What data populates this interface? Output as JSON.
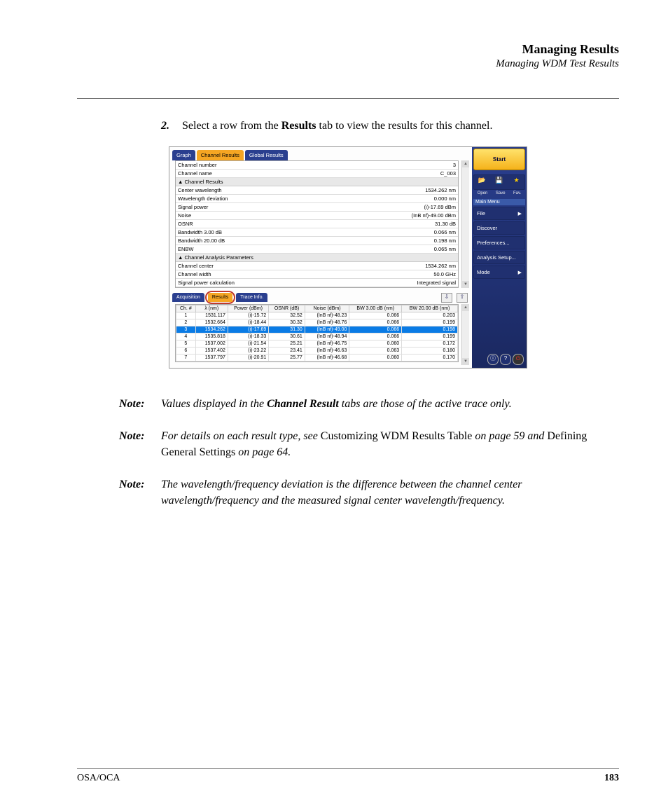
{
  "header": {
    "title": "Managing Results",
    "subtitle": "Managing WDM Test Results"
  },
  "step": {
    "num": "2.",
    "before": "Select a row from the ",
    "bold": "Results",
    "after": " tab to view the results for this channel."
  },
  "screenshot": {
    "top_tabs": {
      "graph": "Graph",
      "channel_results": "Channel Results",
      "global_results": "Global Results"
    },
    "detail_rows": [
      {
        "label": "Channel number",
        "value": "3"
      },
      {
        "label": "Channel name",
        "value": "C_003"
      }
    ],
    "section1": "▲ Channel Results",
    "channel_results_rows": [
      {
        "label": "Center wavelength",
        "value": "1534.262 nm"
      },
      {
        "label": "Wavelength deviation",
        "value": "0.000 nm"
      },
      {
        "label": "Signal power",
        "value": "(i)-17.69 dBm"
      },
      {
        "label": "Noise",
        "value": "(InB nf)-49.00 dBm"
      },
      {
        "label": "OSNR",
        "value": "31.30 dB"
      },
      {
        "label": "Bandwidth 3.00 dB",
        "value": "0.066 nm"
      },
      {
        "label": "Bandwidth 20.00 dB",
        "value": "0.198 nm"
      },
      {
        "label": "ENBW",
        "value": "0.065 nm"
      }
    ],
    "section2": "▲ Channel Analysis Parameters",
    "analysis_rows": [
      {
        "label": "Channel center",
        "value": "1534.262 nm"
      },
      {
        "label": "Channel width",
        "value": "50.0 GHz"
      },
      {
        "label": "Signal power calculation",
        "value": "Integrated signal"
      }
    ],
    "mid_tabs": {
      "acquisition": "Acquisition",
      "results": "Results",
      "trace_info": "Trace Info."
    },
    "table": {
      "headers": [
        "Ch. #",
        "λ (nm)",
        "Power (dBm)",
        "OSNR (dB)",
        "Noise (dBm)",
        "BW 3.00 dB (nm)",
        "BW 20.00 dB (nm)"
      ],
      "rows": [
        {
          "ch": "1",
          "w": "1531.117",
          "p": "(i)-15.72",
          "o": "32.52",
          "n": "(InB nf)-48.23",
          "b3": "0.066",
          "b20": "0.203",
          "sel": false
        },
        {
          "ch": "2",
          "w": "1532.664",
          "p": "(i)-18.44",
          "o": "30.32",
          "n": "(InB nf)-48.76",
          "b3": "0.066",
          "b20": "0.199",
          "sel": false
        },
        {
          "ch": "3",
          "w": "1534.262",
          "p": "(i)-17.69",
          "o": "31.30",
          "n": "(InB nf)-49.00",
          "b3": "0.066",
          "b20": "0.198",
          "sel": true
        },
        {
          "ch": "4",
          "w": "1535.818",
          "p": "(i)-18.33",
          "o": "30.61",
          "n": "(InB nf)-48.94",
          "b3": "0.066",
          "b20": "0.199",
          "sel": false
        },
        {
          "ch": "5",
          "w": "1537.002",
          "p": "(i)-21.54",
          "o": "25.21",
          "n": "(InB nf)-46.75",
          "b3": "0.060",
          "b20": "0.172",
          "sel": false
        },
        {
          "ch": "6",
          "w": "1537.402",
          "p": "(i)-23.22",
          "o": "23.41",
          "n": "(InB nf)-46.63",
          "b3": "0.063",
          "b20": "0.180",
          "sel": false
        },
        {
          "ch": "7",
          "w": "1537.797",
          "p": "(i)-20.91",
          "o": "25.77",
          "n": "(InB nf)-46.68",
          "b3": "0.060",
          "b20": "0.170",
          "sel": false
        }
      ]
    },
    "sidebar": {
      "start": "Start",
      "icons": {
        "open": "Open",
        "save": "Save",
        "fav": "Fav."
      },
      "menu_title": "Main Menu",
      "items": [
        {
          "label": "File",
          "arrow": true
        },
        {
          "label": "Discover",
          "arrow": false
        },
        {
          "label": "Preferences...",
          "arrow": false
        },
        {
          "label": "Analysis Setup...",
          "arrow": false
        },
        {
          "label": "Mode",
          "arrow": true
        }
      ]
    }
  },
  "notes": [
    {
      "label": "Note:",
      "parts": [
        {
          "t": "Values displayed in the ",
          "s": "i"
        },
        {
          "t": "Channel Result",
          "s": "bi"
        },
        {
          "t": " tabs are those of the active trace only.",
          "s": "i"
        }
      ]
    },
    {
      "label": "Note:",
      "parts": [
        {
          "t": "For details on each result type, see ",
          "s": "i"
        },
        {
          "t": "Customizing WDM Results Table",
          "s": "r"
        },
        {
          "t": " on page 59 and ",
          "s": "i"
        },
        {
          "t": "Defining General Settings",
          "s": "r"
        },
        {
          "t": " on page 64.",
          "s": "i"
        }
      ]
    },
    {
      "label": "Note:",
      "parts": [
        {
          "t": "The wavelength/frequency deviation is the difference between the channel center wavelength/frequency and the measured signal center wavelength/frequency.",
          "s": "i"
        }
      ]
    }
  ],
  "footer": {
    "left": "OSA/OCA",
    "right": "183"
  }
}
